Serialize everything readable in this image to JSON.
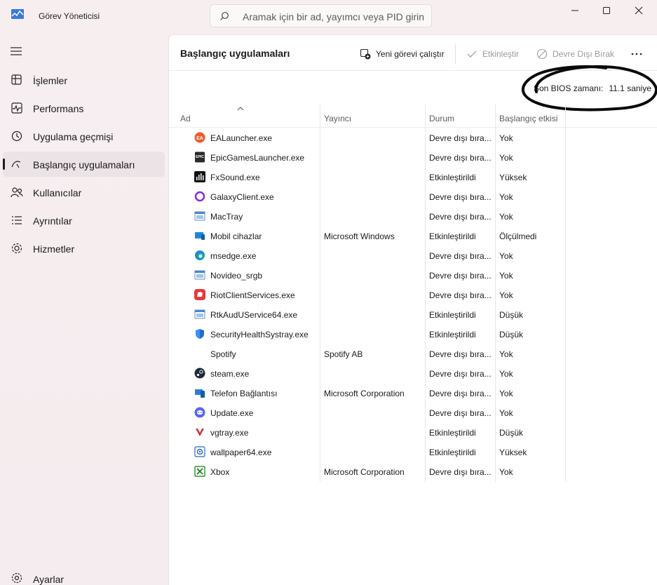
{
  "window": {
    "title": "Görev Yöneticisi",
    "search_placeholder": "Aramak için bir ad, yayımcı veya PID girin"
  },
  "sidebar": {
    "items": [
      {
        "label": "İşlemler",
        "icon": "processes-icon"
      },
      {
        "label": "Performans",
        "icon": "performance-icon"
      },
      {
        "label": "Uygulama geçmişi",
        "icon": "app-history-icon"
      },
      {
        "label": "Başlangıç uygulamaları",
        "icon": "startup-icon",
        "active": true
      },
      {
        "label": "Kullanıcılar",
        "icon": "users-icon"
      },
      {
        "label": "Ayrıntılar",
        "icon": "details-icon"
      },
      {
        "label": "Hizmetler",
        "icon": "services-icon"
      }
    ],
    "settings_label": "Ayarlar"
  },
  "toolbar": {
    "page_title": "Başlangıç uygulamaları",
    "new_task": "Yeni görevi çalıştır",
    "enable": "Etkinleştir",
    "disable": "Devre Dışı Bırak"
  },
  "bios": {
    "label": "Son BIOS zamanı:",
    "value": "11.1 saniye"
  },
  "table": {
    "columns": [
      "Ad",
      "Yayıncı",
      "Durum",
      "Başlangıç etkisi"
    ],
    "rows": [
      {
        "name": "EALauncher.exe",
        "publisher": "",
        "status": "Devre dışı bıra...",
        "impact": "Yok",
        "icon": "ea-icon"
      },
      {
        "name": "EpicGamesLauncher.exe",
        "publisher": "",
        "status": "Devre dışı bıra...",
        "impact": "Yok",
        "icon": "epic-icon"
      },
      {
        "name": "FxSound.exe",
        "publisher": "",
        "status": "Etkinleştirildi",
        "impact": "Yüksek",
        "icon": "fxsound-icon"
      },
      {
        "name": "GalaxyClient.exe",
        "publisher": "",
        "status": "Devre dışı bıra...",
        "impact": "Yok",
        "icon": "galaxy-icon"
      },
      {
        "name": "MacTray",
        "publisher": "",
        "status": "Devre dışı bıra...",
        "impact": "Yok",
        "icon": "window-app-icon"
      },
      {
        "name": "Mobil cihazlar",
        "publisher": "Microsoft Windows",
        "status": "Etkinleştirildi",
        "impact": "Ölçülmedi",
        "icon": "mobile-devices-icon"
      },
      {
        "name": "msedge.exe",
        "publisher": "",
        "status": "Devre dışı bıra...",
        "impact": "Yok",
        "icon": "edge-icon"
      },
      {
        "name": "Novideo_srgb",
        "publisher": "",
        "status": "Devre dışı bıra...",
        "impact": "Yok",
        "icon": "window-app-icon"
      },
      {
        "name": "RiotClientServices.exe",
        "publisher": "",
        "status": "Devre dışı bıra...",
        "impact": "Yok",
        "icon": "riot-icon"
      },
      {
        "name": "RtkAudUService64.exe",
        "publisher": "",
        "status": "Etkinleştirildi",
        "impact": "Düşük",
        "icon": "window-app-icon"
      },
      {
        "name": "SecurityHealthSystray.exe",
        "publisher": "",
        "status": "Etkinleştirildi",
        "impact": "Düşük",
        "icon": "shield-icon"
      },
      {
        "name": "Spotify",
        "publisher": "Spotify AB",
        "status": "Devre dışı bıra...",
        "impact": "Yok",
        "icon": ""
      },
      {
        "name": "steam.exe",
        "publisher": "",
        "status": "Devre dışı bıra...",
        "impact": "Yok",
        "icon": "steam-icon"
      },
      {
        "name": "Telefon Bağlantısı",
        "publisher": "Microsoft Corporation",
        "status": "Devre dışı bıra...",
        "impact": "Yok",
        "icon": "phone-link-icon"
      },
      {
        "name": "Update.exe",
        "publisher": "",
        "status": "Devre dışı bıra...",
        "impact": "Yok",
        "icon": "discord-icon"
      },
      {
        "name": "vgtray.exe",
        "publisher": "",
        "status": "Etkinleştirildi",
        "impact": "Düşük",
        "icon": "vanguard-icon"
      },
      {
        "name": "wallpaper64.exe",
        "publisher": "",
        "status": "Etkinleştirildi",
        "impact": "Yüksek",
        "icon": "wallpaper-icon"
      },
      {
        "name": "Xbox",
        "publisher": "Microsoft Corporation",
        "status": "Devre dışı bıra...",
        "impact": "Yok",
        "icon": "xbox-icon"
      }
    ]
  }
}
